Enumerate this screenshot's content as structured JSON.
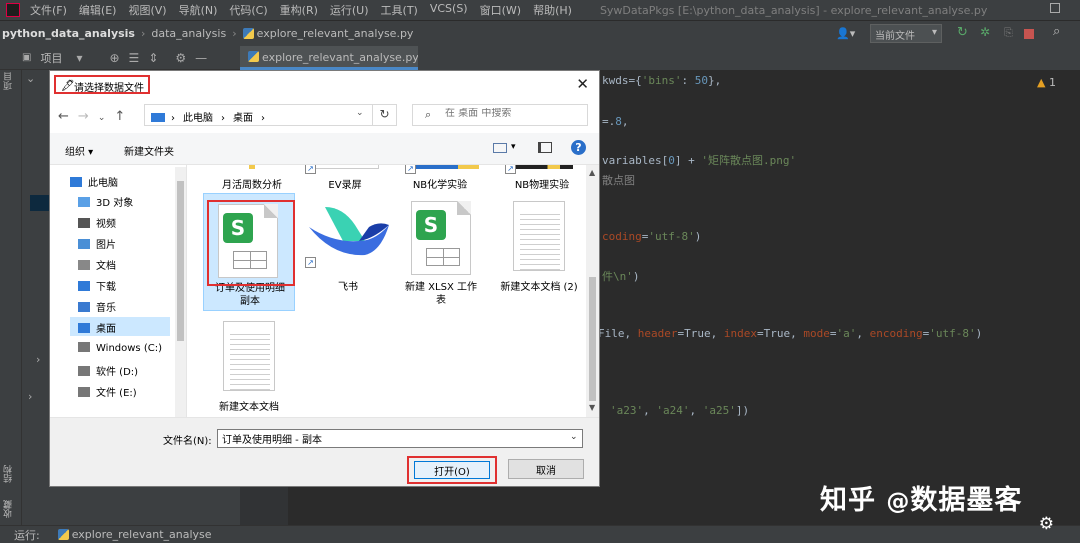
{
  "ide": {
    "menu": [
      "文件(F)",
      "编辑(E)",
      "视图(V)",
      "导航(N)",
      "代码(C)",
      "重构(R)",
      "运行(U)",
      "工具(T)",
      "VCS(S)",
      "窗口(W)",
      "帮助(H)"
    ],
    "window_title": "SywDataPkgs [E:\\python_data_analysis] - explore_relevant_analyse.py",
    "breadcrumb": {
      "project": "python_data_analysis",
      "folder": "data_analysis",
      "file": "explore_relevant_analyse.py"
    },
    "run_config": "当前文件",
    "toolwindow": {
      "title": "项目"
    },
    "editor_tab": "explore_relevant_analyse.py",
    "warning_count": "1",
    "code_lines": [
      {
        "parts": [
          [
            "p",
            "kwds={"
          ],
          [
            "s",
            "'bins'"
          ],
          [
            "p",
            ": "
          ],
          [
            "n",
            "50"
          ],
          [
            "p",
            "},"
          ]
        ]
      },
      {
        "parts": [
          [
            "p",
            "=."
          ],
          [
            "n",
            "8"
          ],
          [
            "p",
            ","
          ]
        ]
      },
      {
        "parts": [
          [
            "p",
            "variables["
          ],
          [
            "n",
            "0"
          ],
          [
            "p",
            "] + "
          ],
          [
            "s",
            "'矩阵散点图.png'"
          ]
        ]
      },
      {
        "parts": [
          [
            "c",
            "散点图"
          ]
        ]
      },
      {
        "parts": [
          [
            "k",
            "coding"
          ],
          [
            "p",
            "="
          ],
          [
            "s",
            "'utf-8'"
          ],
          [
            "p",
            ")"
          ]
        ]
      },
      {
        "parts": [
          [
            "s",
            "件\\n'"
          ],
          [
            "p",
            ")"
          ]
        ]
      },
      {
        "parts": [
          [
            "p",
            "File, "
          ],
          [
            "k",
            "header"
          ],
          [
            "p",
            "=True, "
          ],
          [
            "k",
            "index"
          ],
          [
            "p",
            "=True, "
          ],
          [
            "k",
            "mode"
          ],
          [
            "p",
            "="
          ],
          [
            "s",
            "'a'"
          ],
          [
            "p",
            ", "
          ],
          [
            "k",
            "encoding"
          ],
          [
            "p",
            "="
          ],
          [
            "s",
            "'utf-8'"
          ],
          [
            "p",
            ")"
          ]
        ]
      },
      {
        "parts": [
          [
            "s",
            "'a23'"
          ],
          [
            "p",
            ", "
          ],
          [
            "s",
            "'a24'"
          ],
          [
            "p",
            ", "
          ],
          [
            "s",
            "'a25'"
          ],
          [
            "p",
            "])"
          ]
        ]
      }
    ],
    "status_run_label": "运行:",
    "status_run_config": "explore_relevant_analyse",
    "left_labels": [
      "项目",
      "结构",
      "收藏"
    ]
  },
  "dialog": {
    "title": "请选择数据文件",
    "address": [
      "此电脑",
      "桌面"
    ],
    "search_placeholder": "在 桌面 中搜索",
    "organize": "组织 ▾",
    "new_folder": "新建文件夹",
    "nav_items": [
      {
        "label": "此电脑",
        "icon": "pc-icon",
        "selected": false
      },
      {
        "label": "3D 对象",
        "icon": "cube-icon",
        "selected": false
      },
      {
        "label": "视频",
        "icon": "video-icon",
        "selected": false
      },
      {
        "label": "图片",
        "icon": "picture-icon",
        "selected": false
      },
      {
        "label": "文档",
        "icon": "document-icon",
        "selected": false
      },
      {
        "label": "下载",
        "icon": "download-icon",
        "selected": false
      },
      {
        "label": "音乐",
        "icon": "music-icon",
        "selected": false
      },
      {
        "label": "桌面",
        "icon": "desktop-icon",
        "selected": true
      },
      {
        "label": "Windows (C:)",
        "icon": "drive-icon",
        "selected": false
      },
      {
        "label": "软件 (D:)",
        "icon": "drive-icon",
        "selected": false
      },
      {
        "label": "文件 (E:)",
        "icon": "drive-icon",
        "selected": false
      }
    ],
    "files": {
      "top_row": [
        "月活周数分析",
        "EV录屏",
        "NB化学实验",
        "NB物理实验"
      ],
      "selected_file": "订单及使用明细\n副本",
      "feishu": "飞书",
      "new_xlsx": "新建 XLSX 工作\n表",
      "new_txt_2": "新建文本文档 (2)",
      "new_txt": "新建文本文档"
    },
    "filename_label": "文件名(N):",
    "filename_value": "订单及使用明细 - 副本",
    "open_label": "打开(O)",
    "cancel_label": "取消"
  },
  "watermark": {
    "left": "知乎",
    "right": "数据墨客"
  }
}
